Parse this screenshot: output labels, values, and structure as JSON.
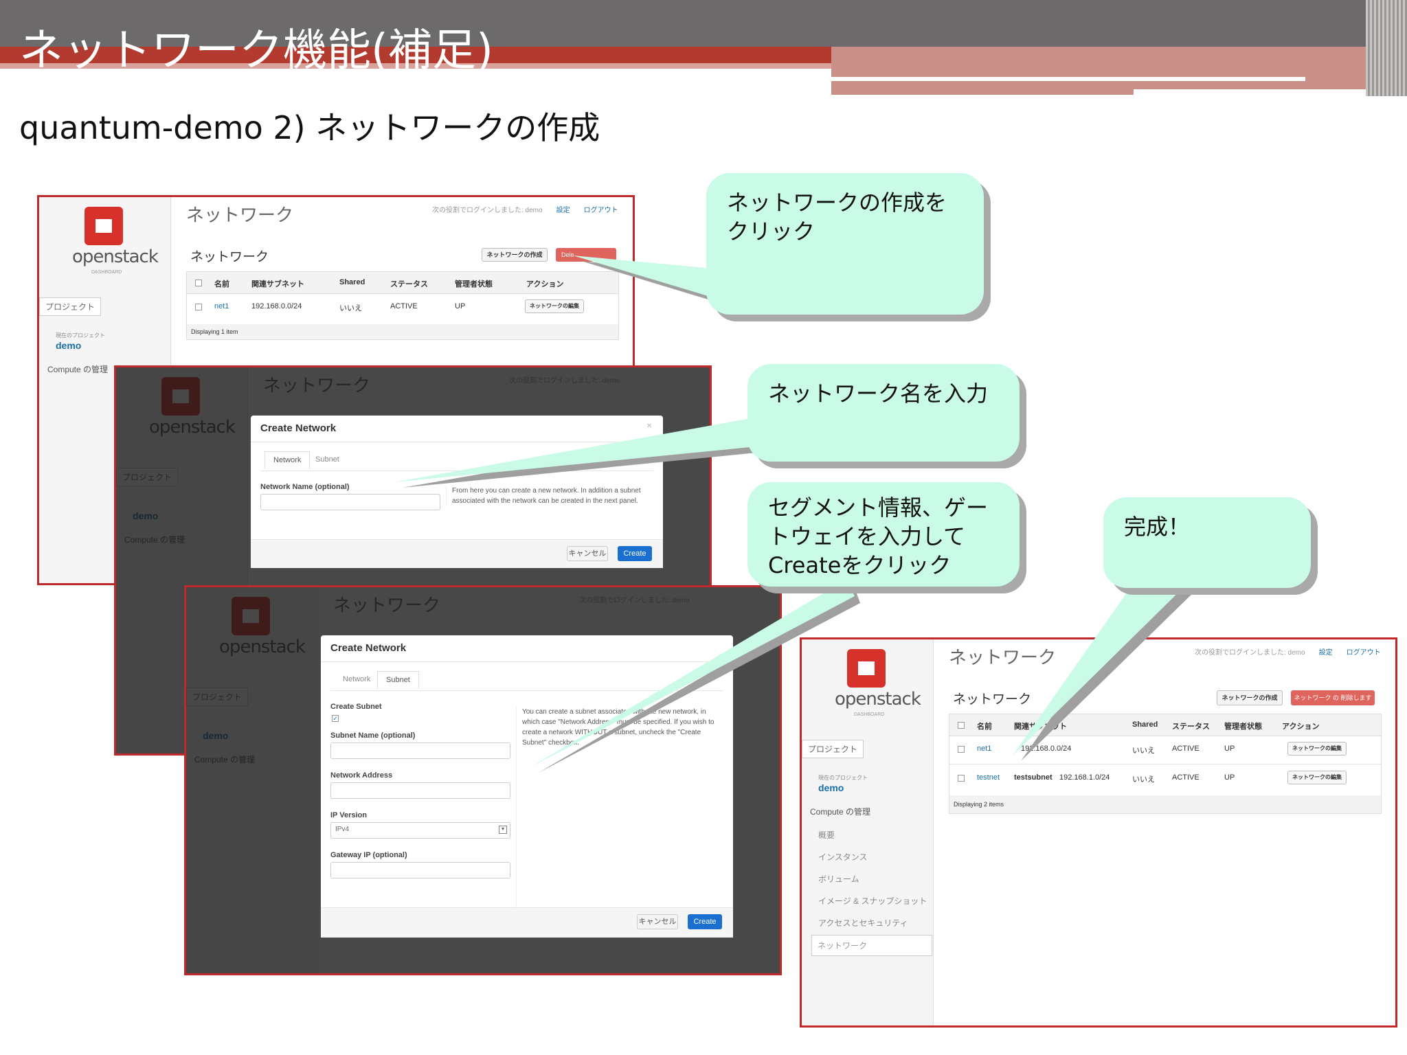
{
  "slide": {
    "title": "ネットワーク機能(補足)",
    "subtitle": "quantum-demo 2) ネットワークの作成"
  },
  "colors": {
    "accent_red": "#c0282a",
    "callout_fill": "#c9fbe6",
    "link_blue": "#1a6fa8",
    "create_blue": "#1a6fd0"
  },
  "callouts": [
    {
      "text": "ネットワークの作成をクリック"
    },
    {
      "text": "ネットワーク名を入力"
    },
    {
      "text": "セグメント情報、ゲートウェイを入力してCreateをクリック"
    },
    {
      "text": "完成！"
    }
  ],
  "dashboard": {
    "logo": "openstack",
    "logo_sub": "DASHBOARD",
    "page_title": "ネットワーク",
    "login_info": "次の役割でログインしました: demo",
    "settings_link": "設定",
    "logout_link": "ログアウト",
    "sidebar": {
      "project_tab": "プロジェクト",
      "current_project_label": "現在のプロジェクト",
      "current_project": "demo",
      "section": "Compute の管理",
      "items": [
        "概要",
        "インスタンス",
        "ボリューム",
        "イメージ & スナップショット",
        "アクセスとセキュリティ"
      ],
      "selected": "ネットワーク"
    },
    "section_title": "ネットワーク",
    "create_button": "ネットワークの作成",
    "delete_button": "ネットワーク の 削除します",
    "delete_button_short": "Dele",
    "columns": [
      "名前",
      "関連サブネット",
      "Shared",
      "ステータス",
      "管理者状態",
      "アクション"
    ],
    "edit_button": "ネットワークの編集",
    "table1": {
      "rows": [
        {
          "name": "net1",
          "subnet": "192.168.0.0/24",
          "shared": "いいえ",
          "status": "ACTIVE",
          "admin": "UP"
        }
      ],
      "footer": "Displaying 1 item"
    },
    "table4": {
      "rows": [
        {
          "name": "net1",
          "subnet": "192.168.0.0/24",
          "shared": "いいえ",
          "status": "ACTIVE",
          "admin": "UP"
        },
        {
          "name": "testnet",
          "subnet_name": "testsubnet",
          "subnet": "192.168.1.0/24",
          "shared": "いいえ",
          "status": "ACTIVE",
          "admin": "UP"
        }
      ],
      "footer": "Displaying 2 items"
    }
  },
  "modal1": {
    "title": "Create Network",
    "close": "×",
    "tabs": [
      "Network",
      "Subnet"
    ],
    "field_label": "Network Name (optional)",
    "help": "From here you can create a new network. In addition a subnet associated with the network can be created in the next panel.",
    "cancel": "キャンセル",
    "create": "Create"
  },
  "modal2": {
    "title": "Create Network",
    "tabs": [
      "Network",
      "Subnet"
    ],
    "create_subnet_label": "Create Subnet",
    "check_mark": "✓",
    "subnet_name_label": "Subnet Name (optional)",
    "network_address_label": "Network Address",
    "ip_version_label": "IP Version",
    "ip_version_value": "IPv4",
    "gateway_label": "Gateway IP (optional)",
    "help": "You can create a subnet associated with the new network, in which case \"Network Address\" must be specified. If you wish to create a network WITHOUT a subnet, uncheck the \"Create Subnet\" checkbox.",
    "cancel": "キャンセル",
    "create": "Create"
  }
}
